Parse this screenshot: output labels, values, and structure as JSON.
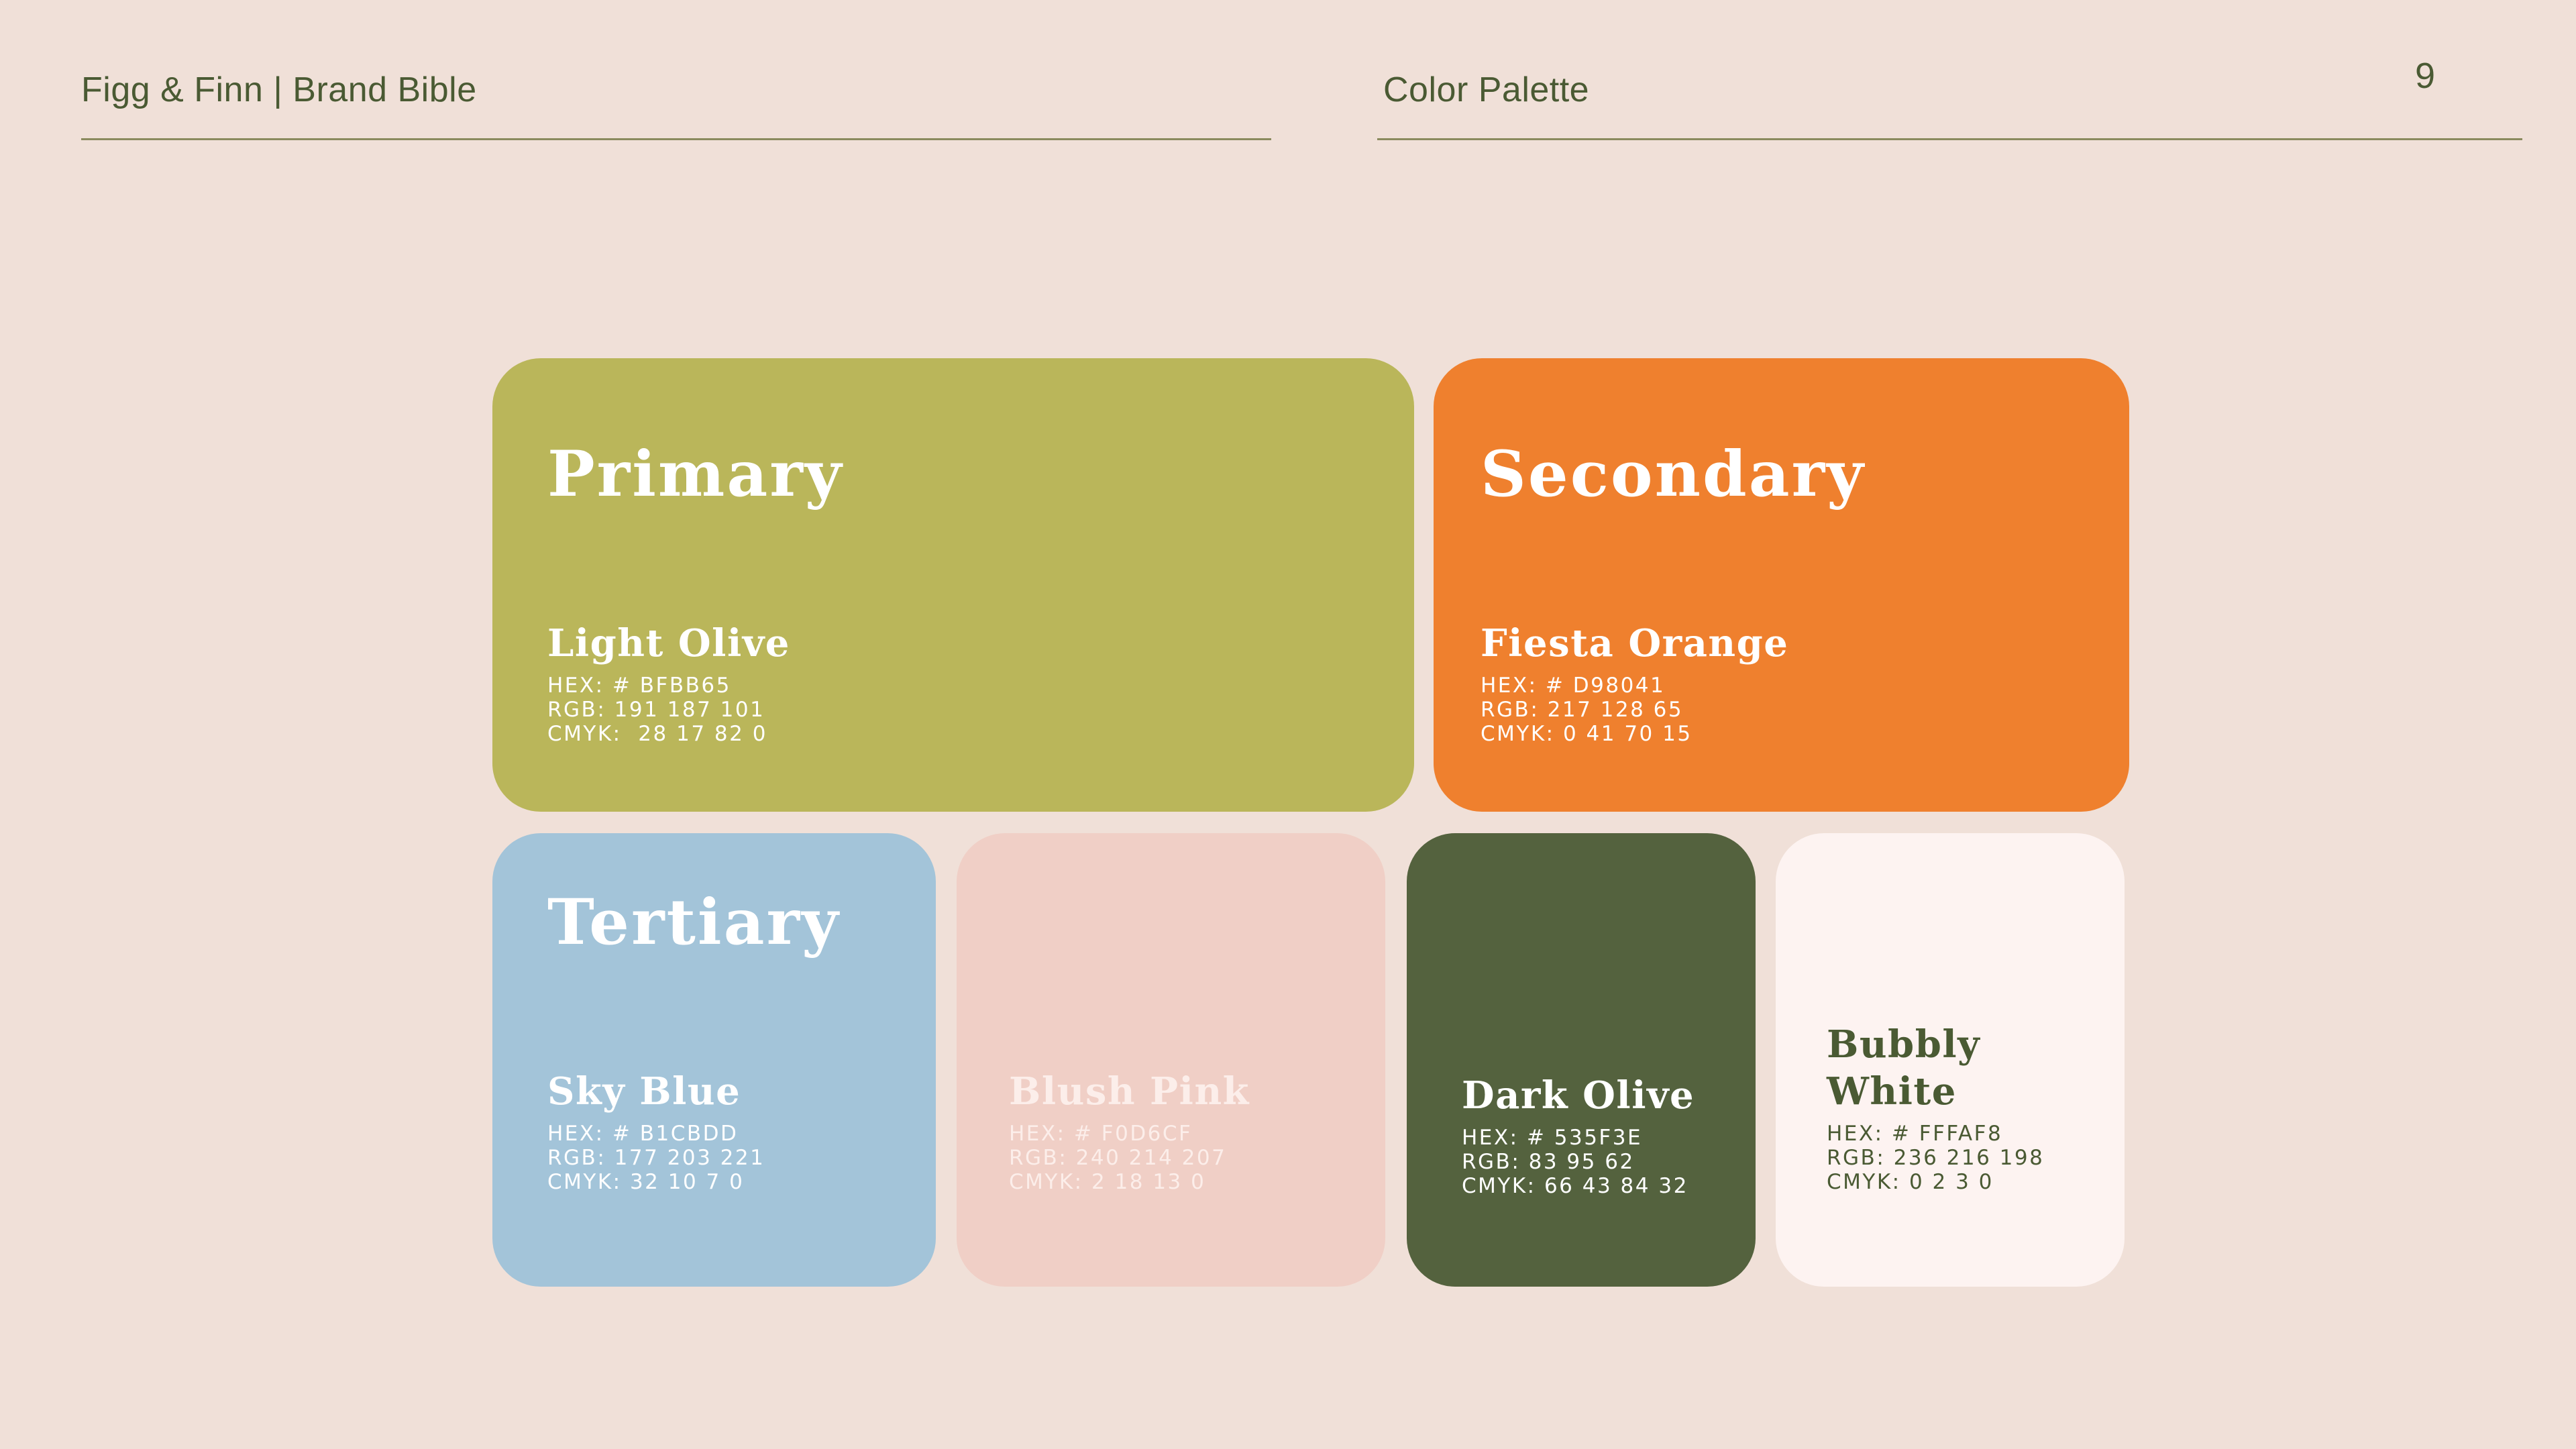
{
  "header": {
    "brand": "Figg & Finn | Brand Bible",
    "section": "Color Palette",
    "page_number": "9"
  },
  "groups": {
    "primary": "Primary",
    "secondary": "Secondary",
    "tertiary": "Tertiary"
  },
  "swatches": {
    "light_olive": {
      "name": "Light Olive",
      "hex": "HEX: # BFBB65",
      "rgb": "RGB: 191 187 101",
      "cmyk": "CMYK:  28 17 82 0",
      "color": "#BAB65A"
    },
    "fiesta_orange": {
      "name": "Fiesta Orange",
      "hex": "HEX: # D98041",
      "rgb": "RGB: 217 128 65",
      "cmyk": "CMYK: 0 41 70 15",
      "color": "#EF802E"
    },
    "sky_blue": {
      "name": "Sky Blue",
      "hex": "HEX: # B1CBDD",
      "rgb": "RGB: 177 203 221",
      "cmyk": "CMYK: 32 10 7 0",
      "color": "#A3C4D9"
    },
    "blush_pink": {
      "name": "Blush Pink",
      "hex": "HEX: # F0D6CF",
      "rgb": "RGB: 240 214 207",
      "cmyk": "CMYK: 2 18 13 0",
      "color": "#F0CFC6"
    },
    "dark_olive": {
      "name": "Dark Olive",
      "hex": "HEX: # 535F3E",
      "rgb": "RGB: 83 95 62",
      "cmyk": "CMYK: 66 43 84 32",
      "color": "#54623E"
    },
    "bubbly_white": {
      "name_line1": "Bubbly",
      "name_line2": "White",
      "hex": "HEX: # FFFAF8",
      "rgb": "RGB: 236 216 198",
      "cmyk": "CMYK: 0 2 3 0",
      "color": "#FDF3F1"
    }
  }
}
